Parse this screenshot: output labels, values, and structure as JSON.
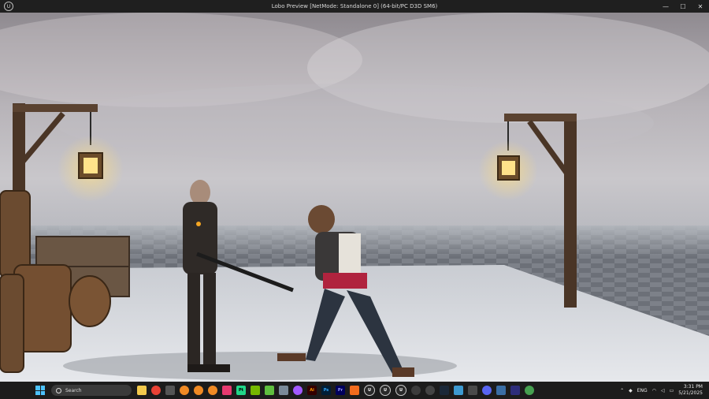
{
  "window": {
    "title": "Lobo Preview [NetMode: Standalone 0]  (64-bit/PC D3D SM6)",
    "logo": "U",
    "minimize_glyph": "—",
    "maximize_glyph": "☐",
    "close_glyph": "✕"
  },
  "taskbar": {
    "search_label": "Search",
    "apps": [
      {
        "name": "file-explorer-app",
        "label": "",
        "color": "#f2c94c"
      },
      {
        "name": "chrome-app",
        "label": "",
        "color": "#e94235"
      },
      {
        "name": "unity-app",
        "label": "",
        "color": "#555555"
      },
      {
        "name": "blender-app",
        "label": "",
        "color": "#f08a24"
      },
      {
        "name": "blender-app-2",
        "label": "",
        "color": "#f08a24"
      },
      {
        "name": "blender-app-3",
        "label": "",
        "color": "#f08a24"
      },
      {
        "name": "affinity-app",
        "label": "",
        "color": "#e63a6f"
      },
      {
        "name": "pycharm-app",
        "label": "Pt",
        "color": "#21d789"
      },
      {
        "name": "nvidia-app",
        "label": "",
        "color": "#76b900"
      },
      {
        "name": "gpu-app",
        "label": "",
        "color": "#5fbf3f"
      },
      {
        "name": "tool-app",
        "label": "",
        "color": "#7a8a99"
      },
      {
        "name": "figma-app",
        "label": "",
        "color": "#a259ff"
      },
      {
        "name": "illustrator-app",
        "label": "Ai",
        "color": "#330000"
      },
      {
        "name": "photoshop-app",
        "label": "Ps",
        "color": "#001e36"
      },
      {
        "name": "premiere-app",
        "label": "Pr",
        "color": "#00005b"
      },
      {
        "name": "substance-app",
        "label": "",
        "color": "#f26b1d"
      },
      {
        "name": "unreal-app",
        "label": "U",
        "color": "#2a2a2a"
      },
      {
        "name": "unreal-app-2",
        "label": "U",
        "color": "#2a2a2a"
      },
      {
        "name": "unreal-app-3",
        "label": "U",
        "color": "#2a2a2a"
      },
      {
        "name": "obs-app",
        "label": "",
        "color": "#3c3c3c"
      },
      {
        "name": "discord-app-alt",
        "label": "",
        "color": "#444444"
      },
      {
        "name": "steam-app",
        "label": "",
        "color": "#1b2838"
      },
      {
        "name": "notes-app",
        "label": "",
        "color": "#3d9ad1"
      },
      {
        "name": "calculator-app",
        "label": "",
        "color": "#4a4a4a"
      },
      {
        "name": "discord-app",
        "label": "",
        "color": "#5865f2"
      },
      {
        "name": "folder-app",
        "label": "",
        "color": "#3a6ea5"
      },
      {
        "name": "game-app",
        "label": "",
        "color": "#2d2d7a"
      },
      {
        "name": "browser-app",
        "label": "",
        "color": "#46a050"
      }
    ],
    "tray": {
      "language": "ENG",
      "time": "3:31 PM",
      "date": "5/21/2025"
    }
  }
}
